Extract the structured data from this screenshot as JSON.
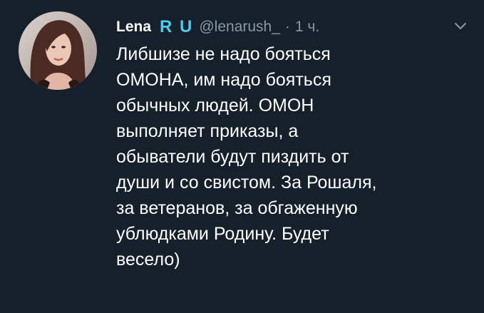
{
  "tweet": {
    "author_name": "Lena",
    "badge": "R U",
    "handle": "@lenarush_",
    "separator": "·",
    "time": "1 ч.",
    "text_lines": [
      "Либшизе не надо бояться",
      "ОМОНА, им надо бояться",
      "обычных людей.  ОМОН",
      "выполняет приказы, а",
      "обыватели будут пиздить от",
      "души и со свистом. За Рошаля,",
      "за ветеранов, за обгаженную",
      "ублюдками Родину. Будет",
      "весело)"
    ]
  },
  "icons": {
    "avatar": "profile-photo",
    "menu": "chevron-down-icon"
  },
  "colors": {
    "background": "#15202b",
    "text": "#ffffff",
    "muted": "#8899a6",
    "badge": "#4ecbf0"
  }
}
